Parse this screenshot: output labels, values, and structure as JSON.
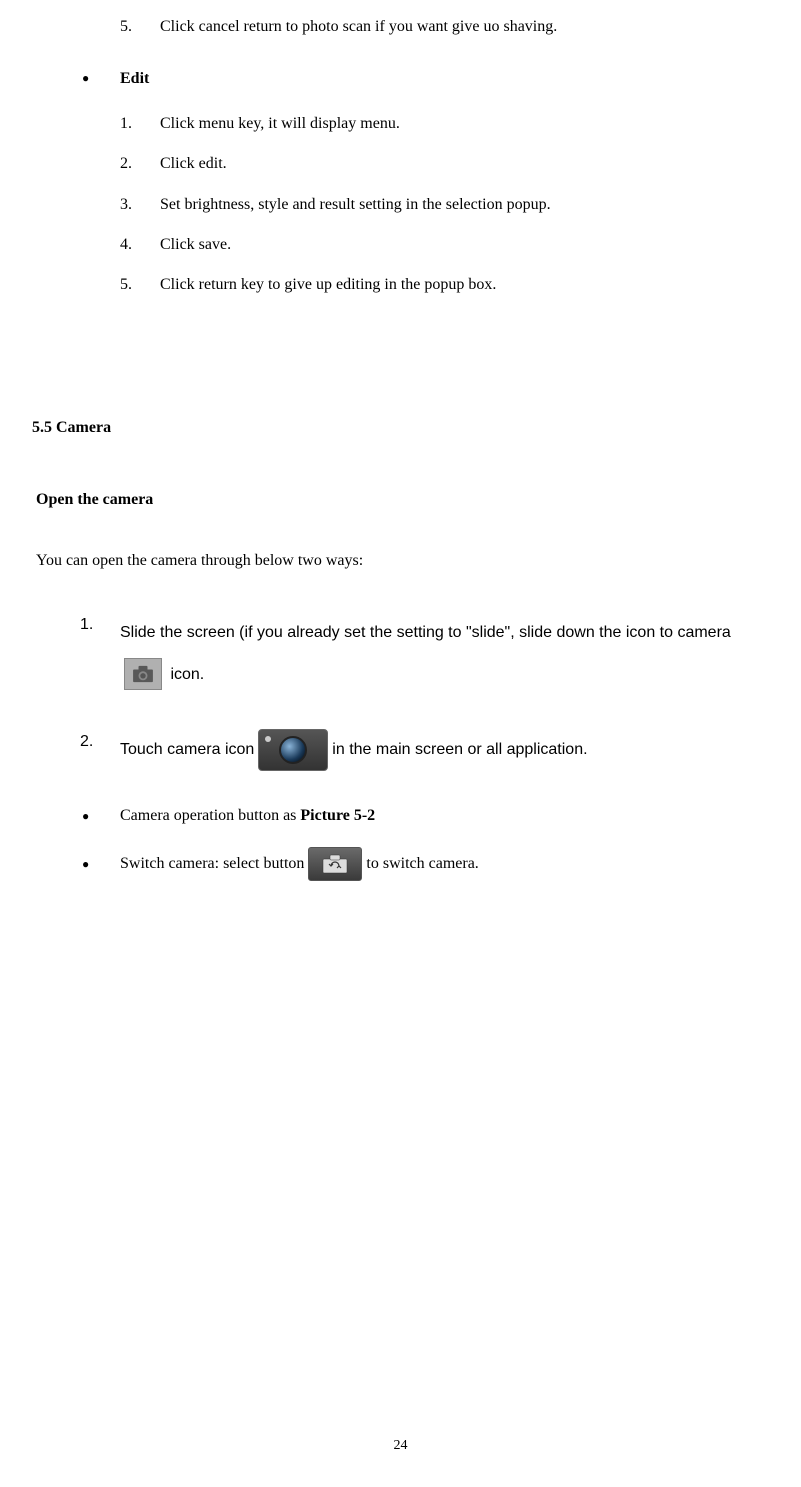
{
  "top_list": {
    "item5": {
      "num": "5.",
      "text": "Click cancel return to photo scan if you want give uo shaving."
    }
  },
  "edit_section": {
    "bullet": "●",
    "label": "Edit",
    "items": [
      {
        "num": "1.",
        "text": "Click menu key, it will display menu."
      },
      {
        "num": "2.",
        "text": "Click edit."
      },
      {
        "num": "3.",
        "text": "Set brightness, style and result setting in the selection popup."
      },
      {
        "num": "4.",
        "text": "Click save."
      },
      {
        "num": "5.",
        "text": "Click return key to give up editing in the popup box."
      }
    ]
  },
  "section_heading": "5.5 Camera",
  "sub_heading": "Open the camera",
  "intro_para": "You can open the camera through below two ways:",
  "open_ways": [
    {
      "num": "1.",
      "text_before": "Slide the screen (if you already set the setting to \"slide\", slide down the icon to camera ",
      "icon": "gray-camera",
      "text_after": " icon."
    },
    {
      "num": "2.",
      "text_before": "Touch camera icon ",
      "icon": "color-camera",
      "text_after": " in the main screen or all application."
    }
  ],
  "camera_bullets": [
    {
      "bullet": "●",
      "text_before": "Camera operation button as ",
      "bold_text": "Picture 5-2",
      "text_after": ""
    },
    {
      "bullet": "●",
      "text_before": "Switch camera: select button ",
      "icon": "switch-camera",
      "text_after": " to switch camera."
    }
  ],
  "page_number": "24"
}
